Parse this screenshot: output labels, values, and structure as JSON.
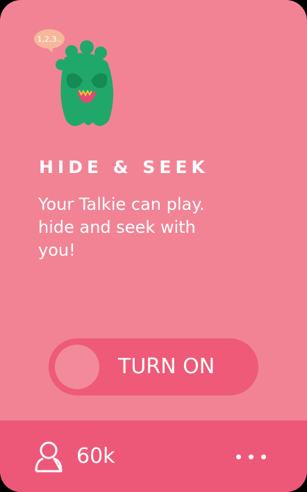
{
  "card": {
    "speech_bubble": "1,2,3..",
    "title": "HIDE & SEEK",
    "description": "Your Talkie can play. hide and seek with you!",
    "toggle": {
      "label": "TURN ON",
      "state": "off"
    },
    "footer": {
      "count": "60k",
      "more_icon": "more-dots-icon",
      "user_icon": "user-icon"
    }
  },
  "colors": {
    "card_bg": "#f18395",
    "footer_bg": "#ee5878",
    "toggle_bg": "#ee5a77",
    "monster": "#1fa86a"
  }
}
